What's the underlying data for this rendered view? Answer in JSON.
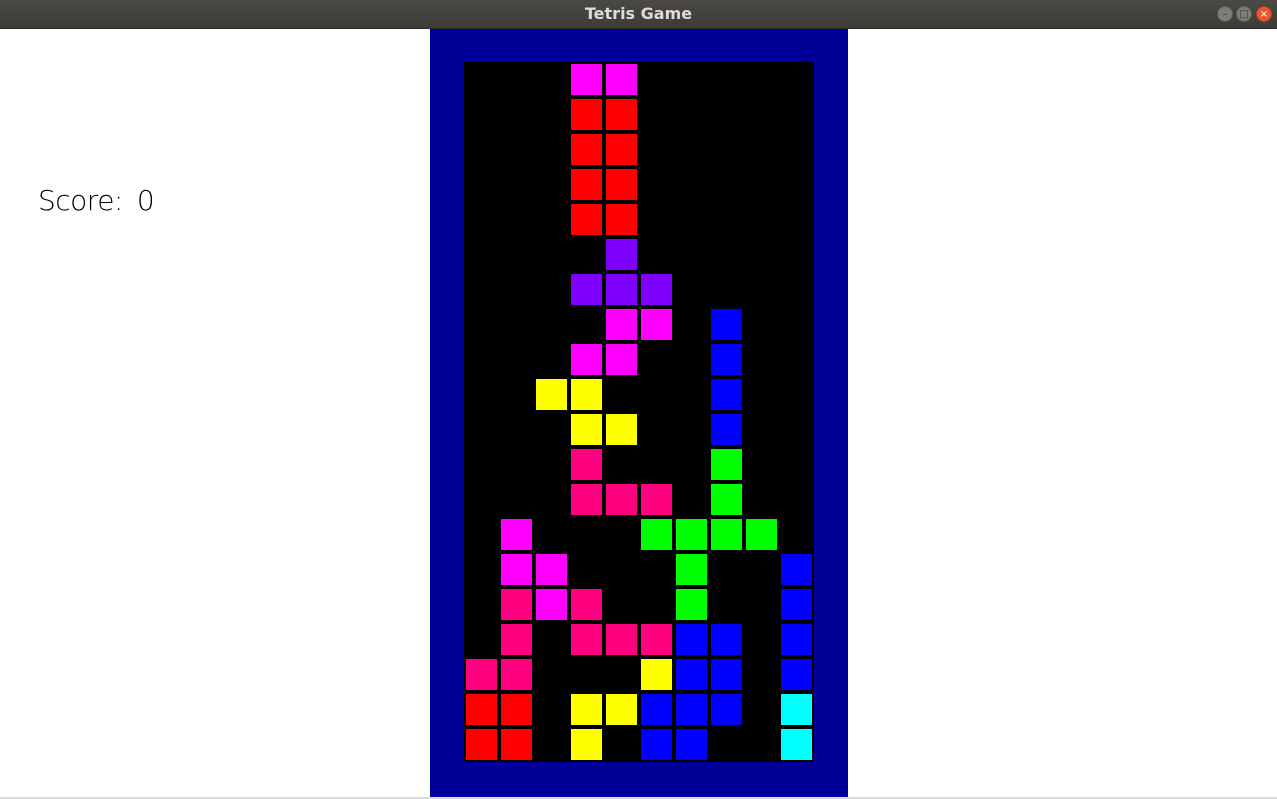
{
  "window": {
    "title": "Tetris Game",
    "controls": [
      "minimize-icon",
      "maximize-icon",
      "close-icon"
    ]
  },
  "score": {
    "label": "Score:",
    "value": "0"
  },
  "board": {
    "columns": 10,
    "rows": 20,
    "background": "#000000",
    "frame_color": "#000099",
    "grid": [
      "...MM.....",
      "...RR.....",
      "...RR.....",
      "...RR.....",
      "...RR.....",
      "....P.....",
      "...PPP....",
      "....MM.B..",
      "...MM..B..",
      "..YY...B..",
      "...YY..B..",
      "...K...G..",
      "...KKK.G..",
      ".M...GGGG.",
      ".MM...G..B",
      ".KMK..G..B",
      ".K.KKKBB.B",
      "KK...YBB.B",
      "RR.YYBBB.C",
      "RR.Y.BB..C"
    ],
    "palette": {
      "R": "#ff0000",
      "M": "#ff00ff",
      "P": "#8000ff",
      "B": "#0000ff",
      "Y": "#ffff00",
      "K": "#ff0080",
      "G": "#00ff00",
      "C": "#00ffff"
    }
  }
}
